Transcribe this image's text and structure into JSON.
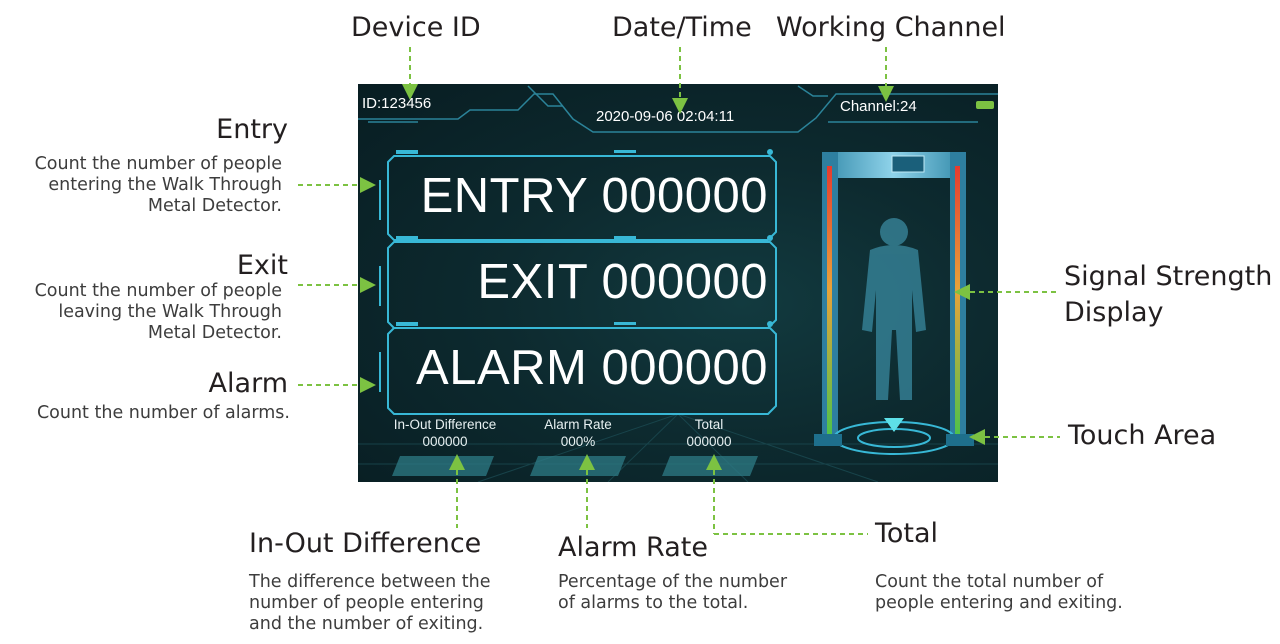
{
  "callouts": {
    "device_id": "Device ID",
    "date_time": "Date/Time",
    "working_channel": "Working Channel",
    "entry": {
      "title": "Entry",
      "desc": [
        "Count the number of people",
        "entering the Walk Through",
        "Metal Detector."
      ]
    },
    "exit": {
      "title": "Exit",
      "desc": [
        "Count the number of people",
        "leaving the Walk Through",
        "Metal Detector."
      ]
    },
    "alarm": {
      "title": "Alarm",
      "desc": [
        "Count the number of alarms."
      ]
    },
    "signal_strength": [
      "Signal Strength",
      "Display"
    ],
    "touch_area": "Touch Area",
    "in_out_difference": {
      "title": "In-Out Difference",
      "desc": [
        "The difference between the",
        "number of people entering",
        "and the number of exiting."
      ]
    },
    "alarm_rate": {
      "title": "Alarm Rate",
      "desc": [
        "Percentage of the number",
        "of alarms to the total."
      ]
    },
    "total": {
      "title": "Total",
      "desc": [
        "Count the total number of",
        "people entering and exiting."
      ]
    }
  },
  "screen": {
    "device_id": "ID:123456",
    "datetime": "2020-09-06 02:04:11",
    "channel": "Channel:24",
    "counters": {
      "entry": "ENTRY  000000",
      "exit": "EXIT    000000",
      "alarm": "ALARM 000000"
    },
    "stats": {
      "in_out_difference": {
        "label": "In-Out Difference",
        "value": "000000"
      },
      "alarm_rate": {
        "label": "Alarm Rate",
        "value": "000%"
      },
      "total": {
        "label": "Total",
        "value": "000000"
      }
    }
  },
  "colors": {
    "pointer": "#7cc242",
    "screen_bg": "#0d2a2f",
    "frame_cyan": "#38b8d6",
    "battery": "#7cc242"
  },
  "icons": [
    "battery-icon",
    "human-silhouette-icon",
    "walk-through-gate-icon",
    "touch-area-icon"
  ]
}
